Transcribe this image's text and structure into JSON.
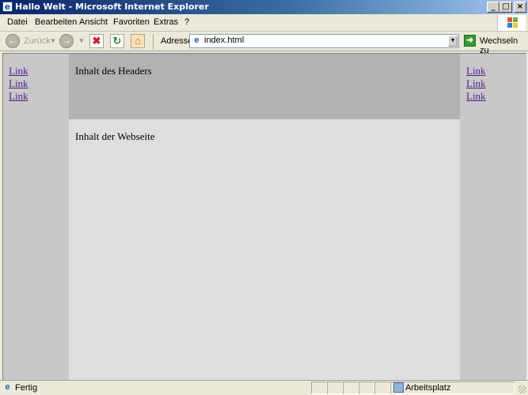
{
  "window": {
    "title": "Hallo Welt - Microsoft Internet Explorer",
    "controls": {
      "minimize": "_",
      "maximize": "□",
      "close": "×"
    }
  },
  "menubar": {
    "items": [
      {
        "label": "Datei"
      },
      {
        "label": "Bearbeiten"
      },
      {
        "label": "Ansicht"
      },
      {
        "label": "Favoriten"
      },
      {
        "label": "Extras"
      },
      {
        "label": "?"
      }
    ]
  },
  "toolbar": {
    "back_label": "Zurück",
    "address_label": "Adresse",
    "address_value": "index.html",
    "go_label": "Wechseln zu"
  },
  "page": {
    "left_links": [
      "Link",
      "Link",
      "Link"
    ],
    "right_links": [
      "Link",
      "Link",
      "Link"
    ],
    "header_text": "Inhalt des Headers",
    "content_text": "Inhalt der Webseite"
  },
  "statusbar": {
    "status_text": "Fertig",
    "zone_text": "Arbeitsplatz"
  },
  "colors": {
    "titlebar_start": "#0a246a",
    "page_side": "#c8c8c8",
    "page_header": "#b1b1b1",
    "page_content": "#dedede",
    "link_visited": "#551a8b"
  }
}
